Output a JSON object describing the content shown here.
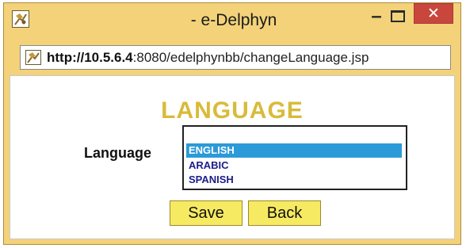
{
  "window": {
    "title": "- e-Delphyn",
    "icon": "app-icon",
    "controls": {
      "minimize": "–",
      "close": "✕"
    }
  },
  "addressbar": {
    "host": "http://10.5.6.4",
    "path": ":8080/edelphynbb/changeLanguage.jsp"
  },
  "page": {
    "heading": "LANGUAGE",
    "language_label": "Language",
    "options": [
      "ENGLISH",
      "ARABIC",
      "SPANISH"
    ],
    "selected_option": "ENGLISH",
    "save_label": "Save",
    "back_label": "Back"
  },
  "colors": {
    "window_frame": "#f3d27a",
    "heading": "#d8bb3a",
    "selected_option": "#2b9ad8",
    "button": "#f7ea63",
    "close_button": "#c9463d"
  }
}
